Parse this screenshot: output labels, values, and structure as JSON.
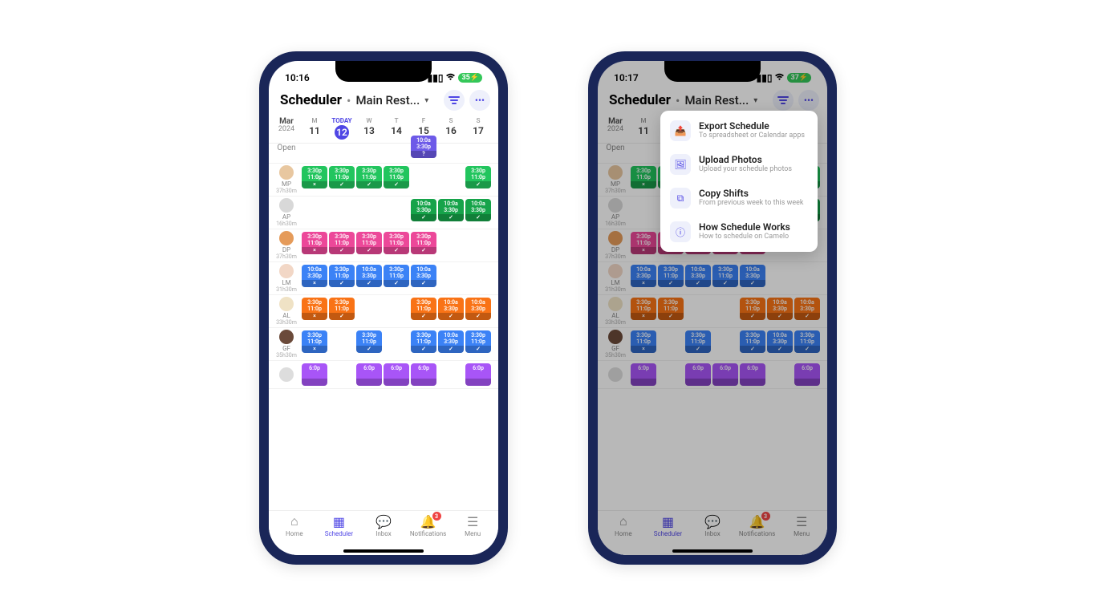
{
  "status": {
    "time1": "10:16",
    "time2": "10:17",
    "battery": "35"
  },
  "header": {
    "title": "Scheduler",
    "location": "Main Rest..."
  },
  "weekLabel": {
    "month": "Mar",
    "year": "2024"
  },
  "days": [
    {
      "dow": "M",
      "num": "11"
    },
    {
      "dow": "TODAY",
      "num": "12",
      "today": true
    },
    {
      "dow": "W",
      "num": "13"
    },
    {
      "dow": "T",
      "num": "14"
    },
    {
      "dow": "F",
      "num": "15"
    },
    {
      "dow": "S",
      "num": "16"
    },
    {
      "dow": "S",
      "num": "17"
    }
  ],
  "openRow": {
    "label": "Open",
    "cells": [
      null,
      null,
      null,
      null,
      {
        "c": "purple",
        "t1": "10:0a",
        "t2": "3:30p",
        "mark": "?"
      },
      null,
      null
    ]
  },
  "rows": [
    {
      "name": "MP",
      "hours": "37h30m",
      "avatar": "#e8c7a0",
      "cells": [
        {
          "c": "green",
          "t1": "3:30p",
          "t2": "11:0p",
          "mark": "×"
        },
        {
          "c": "green",
          "t1": "3:30p",
          "t2": "11:0p",
          "mark": "✓"
        },
        {
          "c": "green",
          "t1": "3:30p",
          "t2": "11:0p",
          "mark": "✓"
        },
        {
          "c": "green",
          "t1": "3:30p",
          "t2": "11:0p",
          "mark": "✓"
        },
        null,
        null,
        {
          "c": "green",
          "t1": "3:30p",
          "t2": "11:0p",
          "mark": "✓"
        }
      ]
    },
    {
      "name": "AP",
      "hours": "16h30m",
      "avatar": "#d8d8d8",
      "cells": [
        null,
        null,
        null,
        null,
        {
          "c": "green2",
          "t1": "10:0a",
          "t2": "3:30p",
          "mark": "✓"
        },
        {
          "c": "green2",
          "t1": "10:0a",
          "t2": "3:30p",
          "mark": "✓"
        },
        {
          "c": "green2",
          "t1": "10:0a",
          "t2": "3:30p",
          "mark": "✓"
        }
      ]
    },
    {
      "name": "DP",
      "hours": "37h30m",
      "avatar": "#e59b5a",
      "cells": [
        {
          "c": "pink",
          "t1": "3:30p",
          "t2": "11:0p",
          "mark": "×"
        },
        {
          "c": "pink",
          "t1": "3:30p",
          "t2": "11:0p",
          "mark": "✓"
        },
        {
          "c": "pink",
          "t1": "3:30p",
          "t2": "11:0p",
          "mark": "✓"
        },
        {
          "c": "pink",
          "t1": "3:30p",
          "t2": "11:0p",
          "mark": "✓"
        },
        {
          "c": "pink",
          "t1": "3:30p",
          "t2": "11:0p",
          "mark": "✓"
        },
        null,
        null
      ]
    },
    {
      "name": "LM",
      "hours": "31h30m",
      "avatar": "#f2d7c6",
      "cells": [
        {
          "c": "blue",
          "t1": "10:0a",
          "t2": "3:30p",
          "mark": "×"
        },
        {
          "c": "blue",
          "t1": "3:30p",
          "t2": "11:0p",
          "mark": "✓"
        },
        {
          "c": "blue",
          "t1": "10:0a",
          "t2": "3:30p",
          "mark": "✓"
        },
        {
          "c": "blue",
          "t1": "3:30p",
          "t2": "11:0p",
          "mark": "✓"
        },
        {
          "c": "blue",
          "t1": "10:0a",
          "t2": "3:30p",
          "mark": "✓"
        },
        null,
        null
      ]
    },
    {
      "name": "AL",
      "hours": "33h30m",
      "avatar": "#efe2c5",
      "cells": [
        {
          "c": "orange",
          "t1": "3:30p",
          "t2": "11:0p",
          "mark": "×"
        },
        {
          "c": "orange",
          "t1": "3:30p",
          "t2": "11:0p",
          "mark": "✓"
        },
        null,
        null,
        {
          "c": "orange",
          "t1": "3:30p",
          "t2": "11:0p",
          "mark": "✓"
        },
        {
          "c": "orange",
          "t1": "10:0a",
          "t2": "3:30p",
          "mark": "✓"
        },
        {
          "c": "orange",
          "t1": "10:0a",
          "t2": "3:30p",
          "mark": "✓"
        }
      ]
    },
    {
      "name": "GF",
      "hours": "35h30m",
      "avatar": "#6b4a3a",
      "cells": [
        {
          "c": "blue",
          "t1": "3:30p",
          "t2": "11:0p",
          "mark": "×"
        },
        null,
        {
          "c": "blue",
          "t1": "3:30p",
          "t2": "11:0p",
          "mark": "✓"
        },
        null,
        {
          "c": "blue",
          "t1": "3:30p",
          "t2": "11:0p",
          "mark": "✓"
        },
        {
          "c": "blue",
          "t1": "10:0a",
          "t2": "3:30p",
          "mark": "✓"
        },
        {
          "c": "blue",
          "t1": "3:30p",
          "t2": "11:0p",
          "mark": "✓"
        }
      ]
    },
    {
      "name": "",
      "hours": "",
      "avatar": "#ddd",
      "cells": [
        {
          "c": "violet",
          "t1": "6:0p",
          "t2": "",
          "mark": ""
        },
        null,
        {
          "c": "violet",
          "t1": "6:0p",
          "t2": "",
          "mark": ""
        },
        {
          "c": "violet",
          "t1": "6:0p",
          "t2": "",
          "mark": ""
        },
        {
          "c": "violet",
          "t1": "6:0p",
          "t2": "",
          "mark": ""
        },
        null,
        {
          "c": "violet",
          "t1": "6:0p",
          "t2": "",
          "mark": ""
        }
      ]
    }
  ],
  "tabs": [
    {
      "label": "Home",
      "icon": "⌂"
    },
    {
      "label": "Scheduler",
      "icon": "▦",
      "active": true
    },
    {
      "label": "Inbox",
      "icon": "💬"
    },
    {
      "label": "Notifications",
      "icon": "🔔",
      "badge": "3"
    },
    {
      "label": "Menu",
      "icon": "☰"
    }
  ],
  "menu": [
    {
      "icon": "📤",
      "title": "Export Schedule",
      "sub": "To spreadsheet or Calendar apps"
    },
    {
      "icon": "🖼",
      "title": "Upload Photos",
      "sub": "Upload your schedule photos"
    },
    {
      "icon": "⧉",
      "title": "Copy Shifts",
      "sub": "From previous week to this week"
    },
    {
      "icon": "ⓘ",
      "title": "How Schedule Works",
      "sub": "How to schedule on Camelo"
    }
  ]
}
